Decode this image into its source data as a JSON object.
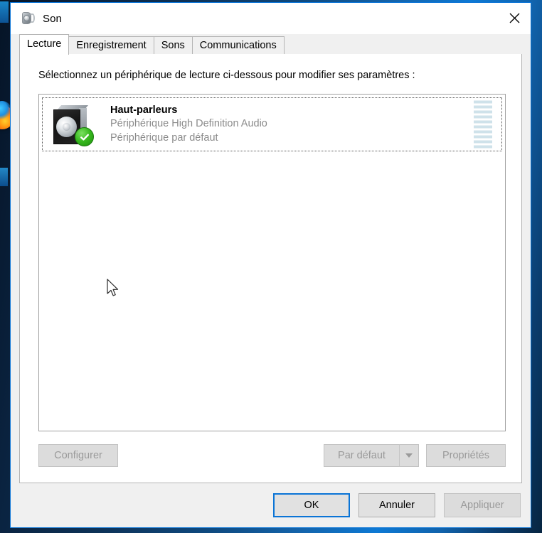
{
  "window": {
    "title": "Son",
    "icon": "speaker-icon",
    "close_label": "×"
  },
  "tabs": [
    {
      "label": "Lecture",
      "active": true
    },
    {
      "label": "Enregistrement",
      "active": false
    },
    {
      "label": "Sons",
      "active": false
    },
    {
      "label": "Communications",
      "active": false
    }
  ],
  "page": {
    "instruction": "Sélectionnez un périphérique de lecture ci-dessous pour modifier ses paramètres :"
  },
  "devices": [
    {
      "name": "Haut-parleurs",
      "description": "Périphérique High Definition Audio",
      "status": "Périphérique par défaut",
      "icon": "speaker-icon",
      "badge": "check-circle-icon",
      "selected": true,
      "meter_bars": 10,
      "meter_active": 0
    }
  ],
  "mid_buttons": {
    "configure": "Configurer",
    "set_default": "Par défaut",
    "properties": "Propriétés"
  },
  "footer_buttons": {
    "ok": "OK",
    "cancel": "Annuler",
    "apply": "Appliquer"
  },
  "colors": {
    "accent": "#0a74d6",
    "meter_bar": "#cfe2ea",
    "badge_green": "#37b81e",
    "subtext": "#8b8b8b",
    "dialog_bg": "#f0f0f0",
    "page_bg": "#ffffff"
  }
}
